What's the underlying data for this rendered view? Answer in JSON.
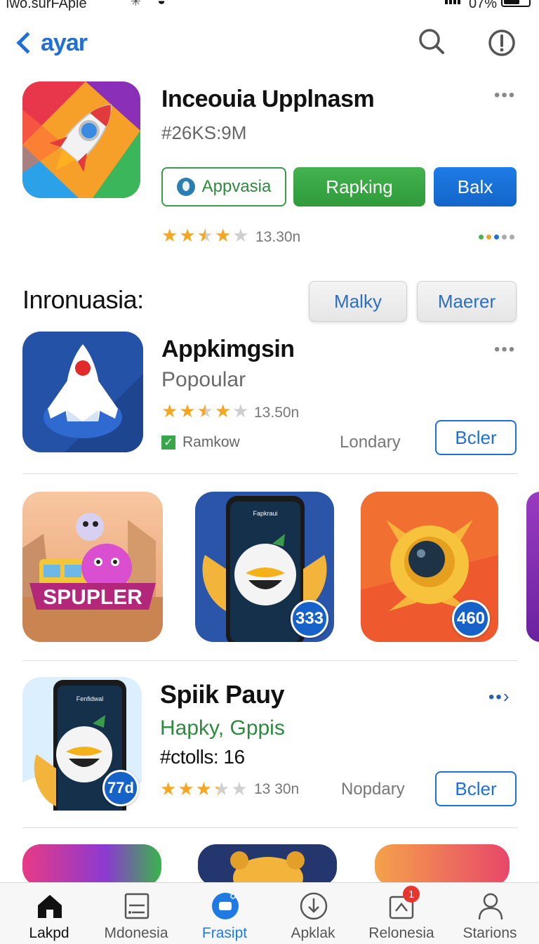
{
  "status_bar": {
    "carrier": "ıwo.surFAple",
    "battery": "07%"
  },
  "nav": {
    "back_label": "ayar"
  },
  "hero": {
    "title": "Inceouia Upplnasm",
    "subtitle": "#26KS:9M",
    "buttons": [
      "Appvasia",
      "Rapking",
      "Balx"
    ],
    "rating": 3.5,
    "rating_text": "13.30n"
  },
  "section": {
    "title": "Inronuasia:",
    "buttons": [
      "Malky",
      "Maerer"
    ]
  },
  "app1": {
    "title": "Appkimgsin",
    "category": "Popoular",
    "rating": 3.5,
    "rating_text": "13.50n",
    "check_label": "Ramkow",
    "meta": "Londary",
    "action": "Bcler"
  },
  "gallery": [
    {
      "banner": "SPUPLER"
    },
    {
      "screen_title": "Fapkraui",
      "badge": "333"
    },
    {
      "badge": "460"
    }
  ],
  "app2": {
    "title": "Spiik Pauy",
    "category": "Hapky, Gppis",
    "count": "#ctolls: 16",
    "badge": "77d",
    "screen_title": "Fenfidwal",
    "rating": 3,
    "rating_text": "13 30n",
    "meta": "Nopdary",
    "action": "Bcler"
  },
  "tabs": [
    {
      "label": "Lakpd",
      "icon": "home-icon"
    },
    {
      "label": "Mdonesia",
      "icon": "document-icon"
    },
    {
      "label": "Frasipt",
      "icon": "chat-icon"
    },
    {
      "label": "Apklak",
      "icon": "download-icon"
    },
    {
      "label": "Relonesia",
      "icon": "updates-icon",
      "badge": "1"
    },
    {
      "label": "Starions",
      "icon": "person-icon"
    }
  ],
  "colors": {
    "accent": "#1f6fd6",
    "green": "#2f9b3c",
    "star": "#f5a623"
  }
}
